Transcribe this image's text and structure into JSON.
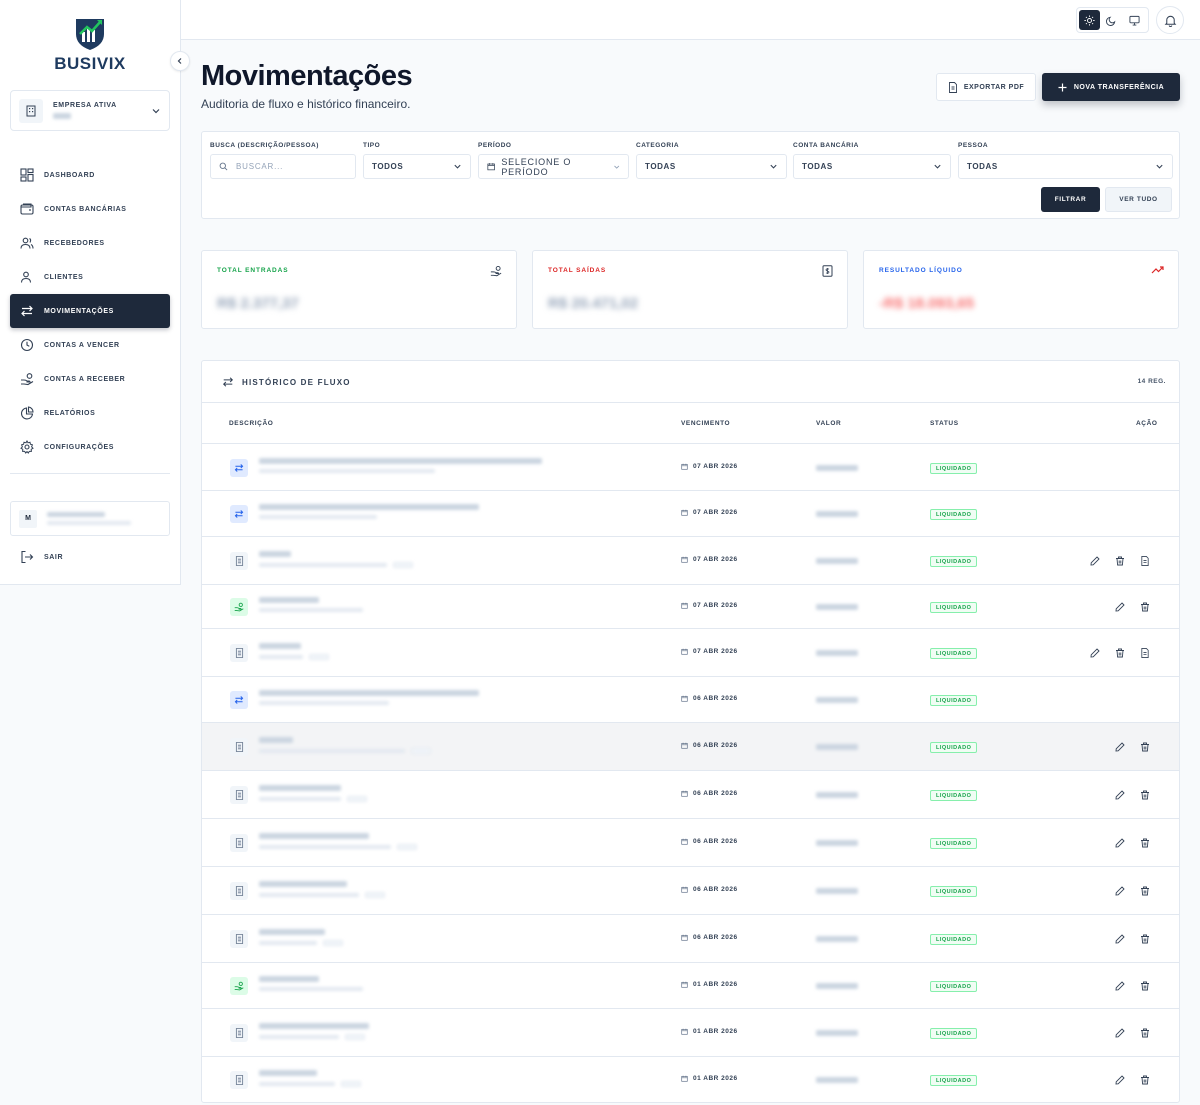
{
  "brand": {
    "name": "BUSIVIX"
  },
  "company": {
    "label": "EMPRESA ATIVA"
  },
  "nav": [
    {
      "id": "dashboard",
      "label": "DASHBOARD",
      "icon": "dashboard-icon",
      "active": false
    },
    {
      "id": "contas-bancarias",
      "label": "CONTAS BANCÁRIAS",
      "icon": "wallet-icon",
      "active": false
    },
    {
      "id": "recebedores",
      "label": "RECEBEDORES",
      "icon": "users-icon",
      "active": false
    },
    {
      "id": "clientes",
      "label": "CLIENTES",
      "icon": "user-icon",
      "active": false
    },
    {
      "id": "movimentacoes",
      "label": "MOVIMENTAÇÕES",
      "icon": "transfer-icon",
      "active": true
    },
    {
      "id": "contas-a-vencer",
      "label": "CONTAS A VENCER",
      "icon": "clock-icon",
      "active": false
    },
    {
      "id": "contas-a-receber",
      "label": "CONTAS A RECEBER",
      "icon": "hand-coins-icon",
      "active": false
    },
    {
      "id": "relatorios",
      "label": "RELATÓRIOS",
      "icon": "pie-chart-icon",
      "active": false
    },
    {
      "id": "configuracoes",
      "label": "CONFIGURAÇÕES",
      "icon": "gear-icon",
      "active": false
    }
  ],
  "user": {
    "initial": "M"
  },
  "logout": {
    "label": "SAIR"
  },
  "header": {
    "title": "Movimentações",
    "subtitle": "Auditoria de fluxo e histórico financeiro.",
    "export_label": "EXPORTAR PDF",
    "new_label": "NOVA TRANSFERÊNCIA"
  },
  "filters": {
    "search_label": "BUSCA (DESCRIÇÃO/PESSOA)",
    "search_placeholder": "BUSCAR...",
    "tipo_label": "TIPO",
    "tipo_value": "TODOS",
    "periodo_label": "PERÍODO",
    "periodo_value": "SELECIONE O PERÍODO",
    "categoria_label": "CATEGORIA",
    "categoria_value": "TODAS",
    "conta_label": "CONTA BANCÁRIA",
    "conta_value": "TODAS",
    "pessoa_label": "PESSOA",
    "pessoa_value": "TODAS",
    "filter_btn": "FILTRAR",
    "all_btn": "VER TUDO"
  },
  "stats": {
    "entradas": {
      "label": "TOTAL ENTRADAS",
      "value": "R$ 2.377,37",
      "color": "#16a34a"
    },
    "saidas": {
      "label": "TOTAL SAÍDAS",
      "value": "R$ 20.471,02",
      "color": "#dc2626"
    },
    "resultado": {
      "label": "RESULTADO LÍQUIDO",
      "value": "-R$ 18.093,65",
      "color": "#2563eb"
    }
  },
  "table": {
    "title": "HISTÓRICO DE FLUXO",
    "count": "14 REG.",
    "columns": {
      "desc": "DESCRIÇÃO",
      "venc": "VENCIMENTO",
      "valor": "VALOR",
      "status": "STATUS",
      "acao": "AÇÃO"
    },
    "rows": [
      {
        "type": "transfer",
        "date": "07 ABR 2026",
        "status": "LIQUIDADO",
        "actions": []
      },
      {
        "type": "transfer",
        "date": "07 ABR 2026",
        "status": "LIQUIDADO",
        "actions": []
      },
      {
        "type": "doc",
        "date": "07 ABR 2026",
        "status": "LIQUIDADO",
        "actions": [
          "edit",
          "delete",
          "receipt"
        ]
      },
      {
        "type": "money",
        "date": "07 ABR 2026",
        "status": "LIQUIDADO",
        "actions": [
          "edit",
          "delete"
        ]
      },
      {
        "type": "doc",
        "date": "07 ABR 2026",
        "status": "LIQUIDADO",
        "actions": [
          "edit",
          "delete",
          "receipt"
        ]
      },
      {
        "type": "transfer",
        "date": "06 ABR 2026",
        "status": "LIQUIDADO",
        "actions": []
      },
      {
        "type": "doc",
        "date": "06 ABR 2026",
        "status": "LIQUIDADO",
        "actions": [
          "edit",
          "delete"
        ]
      },
      {
        "type": "doc",
        "date": "06 ABR 2026",
        "status": "LIQUIDADO",
        "actions": [
          "edit",
          "delete"
        ]
      },
      {
        "type": "doc",
        "date": "06 ABR 2026",
        "status": "LIQUIDADO",
        "actions": [
          "edit",
          "delete"
        ]
      },
      {
        "type": "doc",
        "date": "06 ABR 2026",
        "status": "LIQUIDADO",
        "actions": [
          "edit",
          "delete"
        ]
      },
      {
        "type": "doc",
        "date": "06 ABR 2026",
        "status": "LIQUIDADO",
        "actions": [
          "edit",
          "delete"
        ]
      },
      {
        "type": "money",
        "date": "01 ABR 2026",
        "status": "LIQUIDADO",
        "actions": [
          "edit",
          "delete"
        ]
      },
      {
        "type": "doc",
        "date": "01 ABR 2026",
        "status": "LIQUIDADO",
        "actions": [
          "edit",
          "delete"
        ]
      },
      {
        "type": "doc",
        "date": "01 ABR 2026",
        "status": "LIQUIDADO",
        "actions": [
          "edit",
          "delete"
        ]
      }
    ]
  }
}
